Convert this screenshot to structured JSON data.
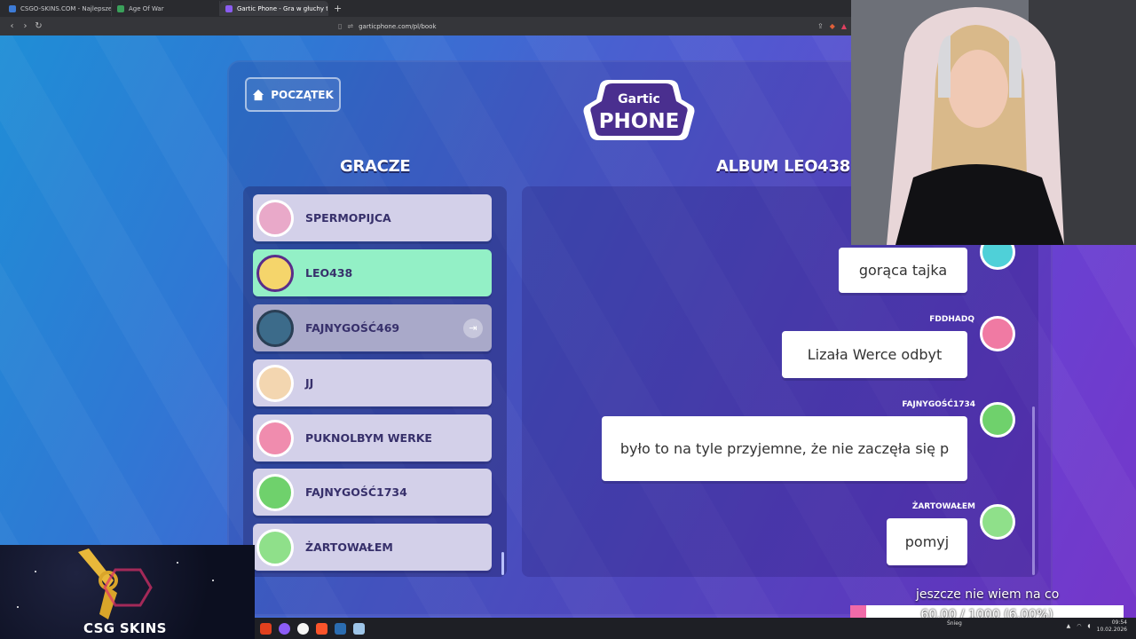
{
  "browser": {
    "tabs": [
      {
        "title": "CSGO-SKINS.COM - Najlepsze Skrzy...",
        "color": "#3d7bd6"
      },
      {
        "title": "Age Of War",
        "color": "#3aa05a"
      },
      {
        "title": "Gartic Phone - Gra w głuchy t...",
        "color": "#8a5cf0"
      }
    ],
    "url": "garticphone.com/pl/book"
  },
  "header": {
    "home_label": "POCZĄTEK",
    "logo_top": "Gartic",
    "logo_bottom": "PHONE"
  },
  "players_heading": "GRACZE",
  "album_heading": "ALBUM LEO438",
  "players": [
    {
      "name": "SPERMOPIJCA",
      "avatar_color": "#e9a9c9"
    },
    {
      "name": "LEO438",
      "avatar_color": "#f5d56b"
    },
    {
      "name": "FAJNYGOŚĆ469",
      "avatar_color": "#3c6b8a"
    },
    {
      "name": "JJ",
      "avatar_color": "#f3d6b0"
    },
    {
      "name": "PUKNOLBYM WERKE",
      "avatar_color": "#f08cae"
    },
    {
      "name": "FAJNYGOŚĆ1734",
      "avatar_color": "#6fd16c"
    },
    {
      "name": "ŻARTOWAŁEM",
      "avatar_color": "#8fe08a"
    }
  ],
  "messages": [
    {
      "author": "",
      "text": "gorąca tajka",
      "avatar_color": "#4fd0d8"
    },
    {
      "author": "FDDHADQ",
      "text": "Lizała Werce odbyt",
      "avatar_color": "#f07aa3"
    },
    {
      "author": "FAJNYGOŚĆ1734",
      "text": "było to na tyle przyjemne, że nie zaczęła się p",
      "avatar_color": "#6fd16c"
    },
    {
      "author": "ŻARTOWAŁEM",
      "text": "pomyj",
      "avatar_color": "#8fe08a"
    }
  ],
  "overlay": {
    "brand": "CSG SKINS",
    "goal_title": "jeszcze nie wiem na co",
    "goal_text": "60.00 / 1000 (6.00%)",
    "goal_fraction": 0.06,
    "goal_color": "#f06aa8"
  },
  "taskbar": {
    "weather": "Śnieg",
    "time": "09:54",
    "date": "10.02.2026"
  }
}
